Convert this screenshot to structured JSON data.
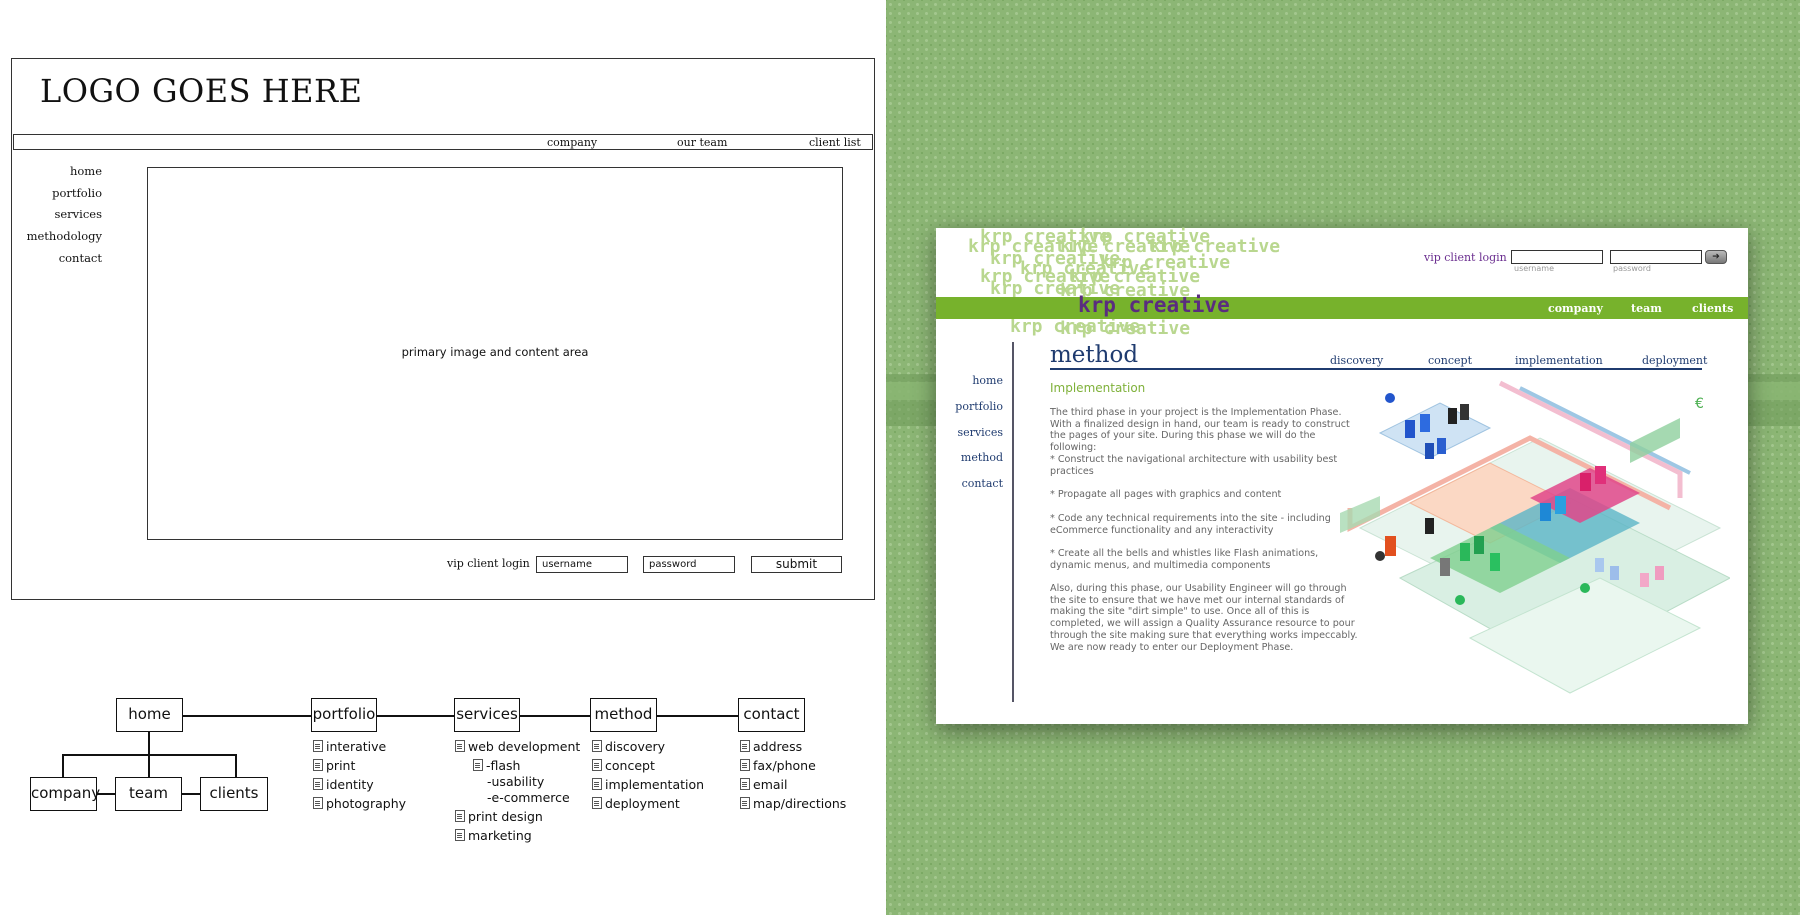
{
  "wireframe": {
    "logo": "LOGO GOES HERE",
    "top_nav": [
      "company",
      "our team",
      "client list"
    ],
    "side_nav": [
      "home",
      "portfolio",
      "services",
      "methodology",
      "contact"
    ],
    "content_label": "primary image and content area",
    "vip_label": "vip client login",
    "username_placeholder": "username",
    "password_placeholder": "password",
    "submit_label": "submit"
  },
  "sitemap": {
    "home": {
      "label": "home",
      "children": [
        "company",
        "team",
        "clients"
      ]
    },
    "portfolio": {
      "label": "portfolio",
      "items": [
        "interative",
        "print",
        "identity",
        "photography"
      ]
    },
    "services": {
      "label": "services",
      "items": [
        "web development",
        "-flash",
        "-usability",
        "-e-commerce",
        "print design",
        "marketing"
      ]
    },
    "method": {
      "label": "method",
      "items": [
        "discovery",
        "concept",
        "implementation",
        "deployment"
      ]
    },
    "contact": {
      "label": "contact",
      "items": [
        "address",
        "fax/phone",
        "email",
        "map/directions"
      ]
    }
  },
  "site": {
    "brand": "krp creative",
    "vip_label": "vip client login",
    "username_hint": "username",
    "password_hint": "password",
    "top_nav": [
      "company",
      "team",
      "clients"
    ],
    "side_nav": [
      "home",
      "portfolio",
      "services",
      "method",
      "contact"
    ],
    "page_title": "method",
    "sub_nav": [
      "discovery",
      "concept",
      "implementation",
      "deployment"
    ],
    "section_title": "Implementation",
    "paragraphs": [
      "The third phase in your project is the Implementation Phase. With a finalized design in hand, our team is ready to construct the pages of your site. During this phase we will do the following:",
      "* Construct the navigational architecture with usability best practices",
      "* Propagate all pages with graphics and content",
      "* Code any technical requirements into the site - including eCommerce functionality and any interactivity",
      "* Create all the bells and whistles like Flash animations, dynamic menus, and multimedia components",
      "Also, during this phase, our Usability Engineer will go through the site to ensure that we have met our internal standards of making the site \"dirt simple\" to use. Once all of this is completed, we will assign a Quality Assurance resource to pour through the site making sure that everything works impeccably. We are now ready to enter our Deployment Phase."
    ],
    "colors": {
      "accent_green": "#77b22c",
      "brand_purple": "#5a2c7f",
      "navy": "#1f3b6f",
      "background_green": "#8cb675"
    }
  }
}
